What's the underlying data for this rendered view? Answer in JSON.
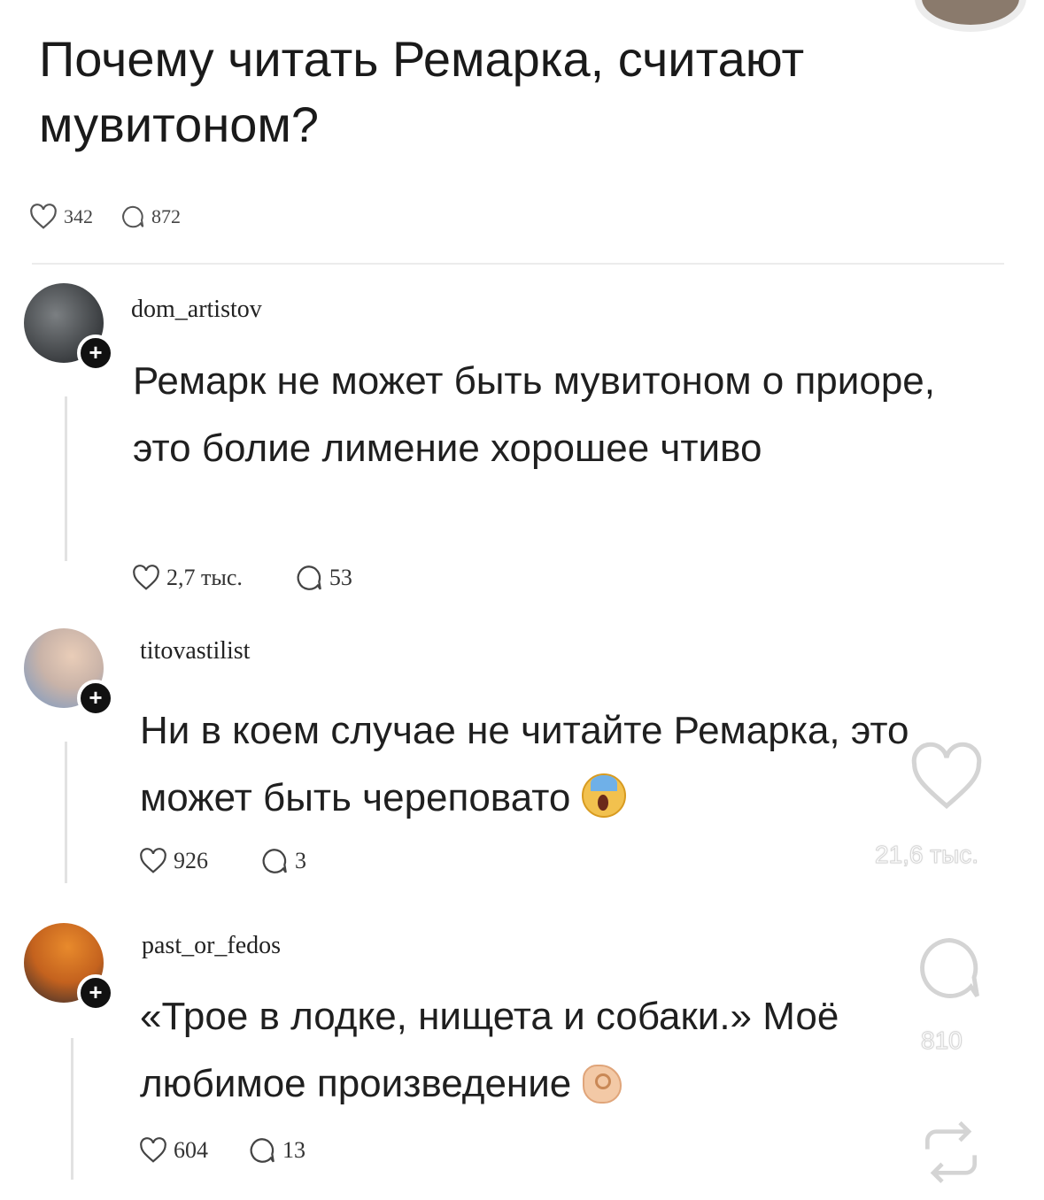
{
  "post": {
    "title": "Почему читать Ремарка, считают мувитоном?",
    "likes": "342",
    "comments": "872"
  },
  "comments": [
    {
      "username": "dom_artistov",
      "text": "Ремарк не может быть мувитоном о приоре, это болие лимение хорошее чтиво",
      "likes": "2,7 тыс.",
      "replies": "53"
    },
    {
      "username": "titovastilist",
      "text": "Ни в коем случае не читайте Ремарка, это может быть череповато",
      "emoji": "screaming-face-emoji",
      "likes": "926",
      "replies": "3"
    },
    {
      "username": "past_or_fedos",
      "text": "«Трое в лодке, нищета и собаки.» Моё любимое произведение",
      "emoji": "ok-hand-emoji",
      "likes": "604",
      "replies": "13"
    }
  ],
  "side_actions": {
    "likes": "21,6 тыс.",
    "comments": "810"
  },
  "icons": [
    "heart-icon",
    "comment-icon",
    "repost-icon",
    "follow-plus-icon"
  ]
}
